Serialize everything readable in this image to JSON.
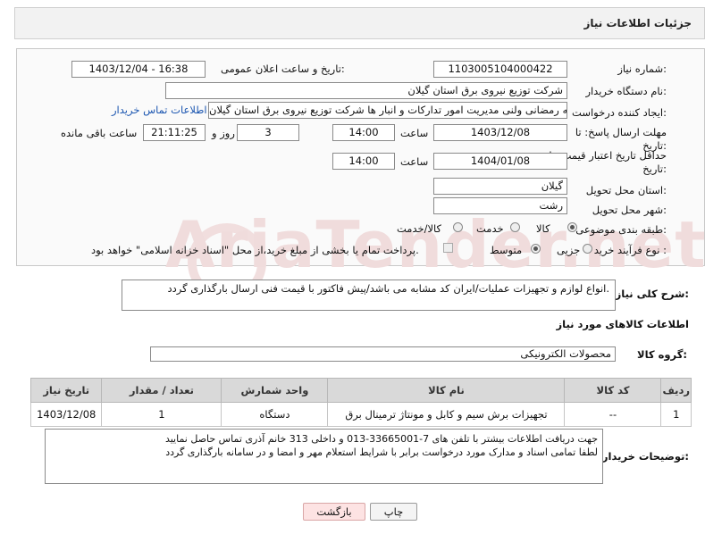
{
  "header": {
    "title": "جزئیات اطلاعات نیاز"
  },
  "fields": {
    "need_number_label": "شماره نیاز:",
    "need_number": "1103005104000422",
    "announce_label": "تاریخ و ساعت اعلان عمومی:",
    "announce_value": "1403/12/04 - 16:38",
    "buyer_org_label": "نام دستگاه خریدار:",
    "buyer_org": "شرکت توزیع نیروی برق استان گیلان",
    "creator_label": "ایجاد کننده درخواست:",
    "creator": "فرشته رمضانی ولنی مدیریت امور تدارکات و انبار ها شرکت توزیع نیروی برق استان گیلان",
    "buyer_contact_link": "اطلاعات تماس خریدار",
    "reply_deadline_label": "مهلت ارسال پاسخ: تا تاریخ:",
    "reply_date": "1403/12/08",
    "time_label": "ساعت",
    "reply_time": "14:00",
    "days": "3",
    "days_label": "روز و",
    "remaining_time": "21:11:25",
    "remaining_label": "ساعت باقی مانده",
    "price_deadline_label": "حداقل تاریخ اعتبار قیمت: تا تاریخ:",
    "price_date": "1404/01/08",
    "price_time": "14:00",
    "province_label": "استان محل تحویل:",
    "province": "گیلان",
    "city_label": "شهر محل تحویل:",
    "city": "رشت",
    "category_label": "طبقه بندی موضوعی:",
    "category_options": [
      "کالا",
      "خدمت",
      "کالا/خدمت"
    ],
    "process_label": "نوع فرآیند خرید :",
    "process_options": [
      "جزیی",
      "متوسط"
    ],
    "payment_note": "پرداخت تمام یا بخشی از مبلغ خرید،از محل \"اسناد خزانه اسلامی\" خواهد بود."
  },
  "description": {
    "label": "شرح کلی نیاز:",
    "text": "انواع لوازم و تجهیزات عملیات/ایران کد مشابه می باشد/پیش فاکتور با قیمت فنی ارسال بارگذاری گردد."
  },
  "goods_section": {
    "title": "اطلاعات کالاهای مورد نیاز",
    "group_label": "گروه کالا:",
    "group_value": "محصولات الکترونیکی"
  },
  "table": {
    "headers": [
      "ردیف",
      "کد کالا",
      "نام کالا",
      "واحد شمارش",
      "تعداد / مقدار",
      "تاریخ نیاز"
    ],
    "rows": [
      [
        "1",
        "--",
        "تجهیزات برش سیم و کابل و مونتاژ ترمینال برق",
        "دستگاه",
        "1",
        "1403/12/08"
      ]
    ]
  },
  "buyer_notes": {
    "label": "توضیحات خریدار:",
    "line1": "جهت دریافت اطلاعات بیشتر با تلفن های 7-33665001-013 و داخلی 313 خانم آذری تماس حاصل نمایید",
    "line2": "لطفا تمامی اسناد و مدارک مورد درخواست برابر با شرایط استعلام مهر و امضا و در سامانه بارگذاری گردد"
  },
  "buttons": {
    "print": "چاپ",
    "back": "بازگشت"
  },
  "watermark": "AriaTender.net",
  "colors": {
    "link": "#1a55b0",
    "back_button": "#fde3e3"
  }
}
